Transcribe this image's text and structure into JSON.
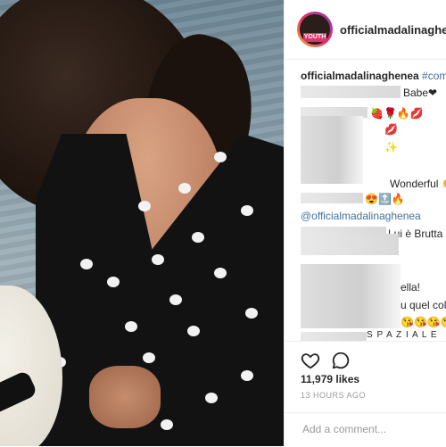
{
  "post": {
    "username": "officialmadalinaghe...",
    "avatar_badge": "YOUTH",
    "caption": {
      "username": "officialmadalinaghenea",
      "hashtag": "#comin"
    },
    "comments": [
      {
        "text": "Babe❤"
      },
      {
        "text": "🍓🌹🔥💋"
      },
      {
        "text": "💋"
      },
      {
        "text": "✨"
      },
      {
        "text": "Wonderful 👏"
      },
      {
        "text": "😍🔝🔥"
      },
      {
        "text": "@officialmadalinaghenea"
      },
      {
        "text": "Lui è Brutta 😂"
      },
      {
        "text": "ella!"
      },
      {
        "text": "u quel coll"
      },
      {
        "text": "😘😘😘😘"
      },
      {
        "text": "S P A Z I A L E"
      }
    ],
    "likes": "11,979 likes",
    "timestamp": "13 HOURS AGO",
    "add_comment_placeholder": "Add a comment..."
  },
  "icons": {
    "like": "heart-icon",
    "comment": "comment-bubble-icon"
  },
  "colors": {
    "link": "#3f729b",
    "text": "#262626",
    "muted": "#999999"
  }
}
